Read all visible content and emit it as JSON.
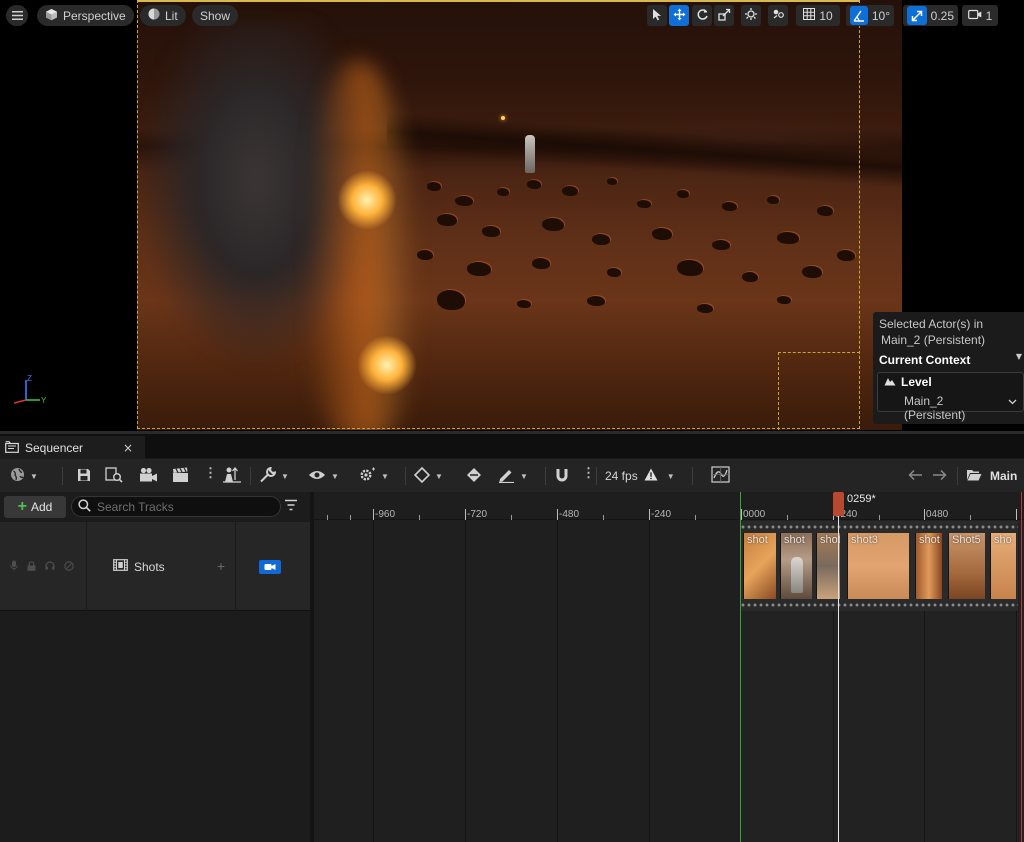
{
  "viewport": {
    "menu_icon": "hamburger-icon",
    "perspective_label": "Perspective",
    "lit_label": "Lit",
    "show_label": "Show",
    "grid_snap_value": "10",
    "rotation_snap_value": "10°",
    "scale_snap_value": "0.25",
    "camera_speed_value": "1"
  },
  "selection_panel": {
    "title_line1": "Selected Actor(s) in",
    "title_line2": "Main_2 (Persistent)",
    "context_label": "Current Context",
    "level_label": "Level",
    "level_value": "Main_2 (Persistent)"
  },
  "sequencer": {
    "tab_label": "Sequencer",
    "tab_close": "×",
    "fps_label": "24 fps",
    "breadcrumb": "Main",
    "add_label": "Add",
    "search_placeholder": "Search Tracks",
    "track_name": "Shots",
    "playhead_frame": "0259*",
    "ruler_labels": [
      "-960",
      "-720",
      "-480",
      "-240",
      "0000",
      "0240",
      "0480"
    ],
    "shots": [
      "shot",
      "shot",
      "shot",
      "shot3",
      "shot",
      "Shot5",
      "sho"
    ]
  },
  "colors": {
    "accent": "#0f6fd8",
    "playhead": "#b6492f",
    "in_marker": "#3aa33a",
    "out_marker": "#b33a3a",
    "frame_border": "#c9a531"
  }
}
